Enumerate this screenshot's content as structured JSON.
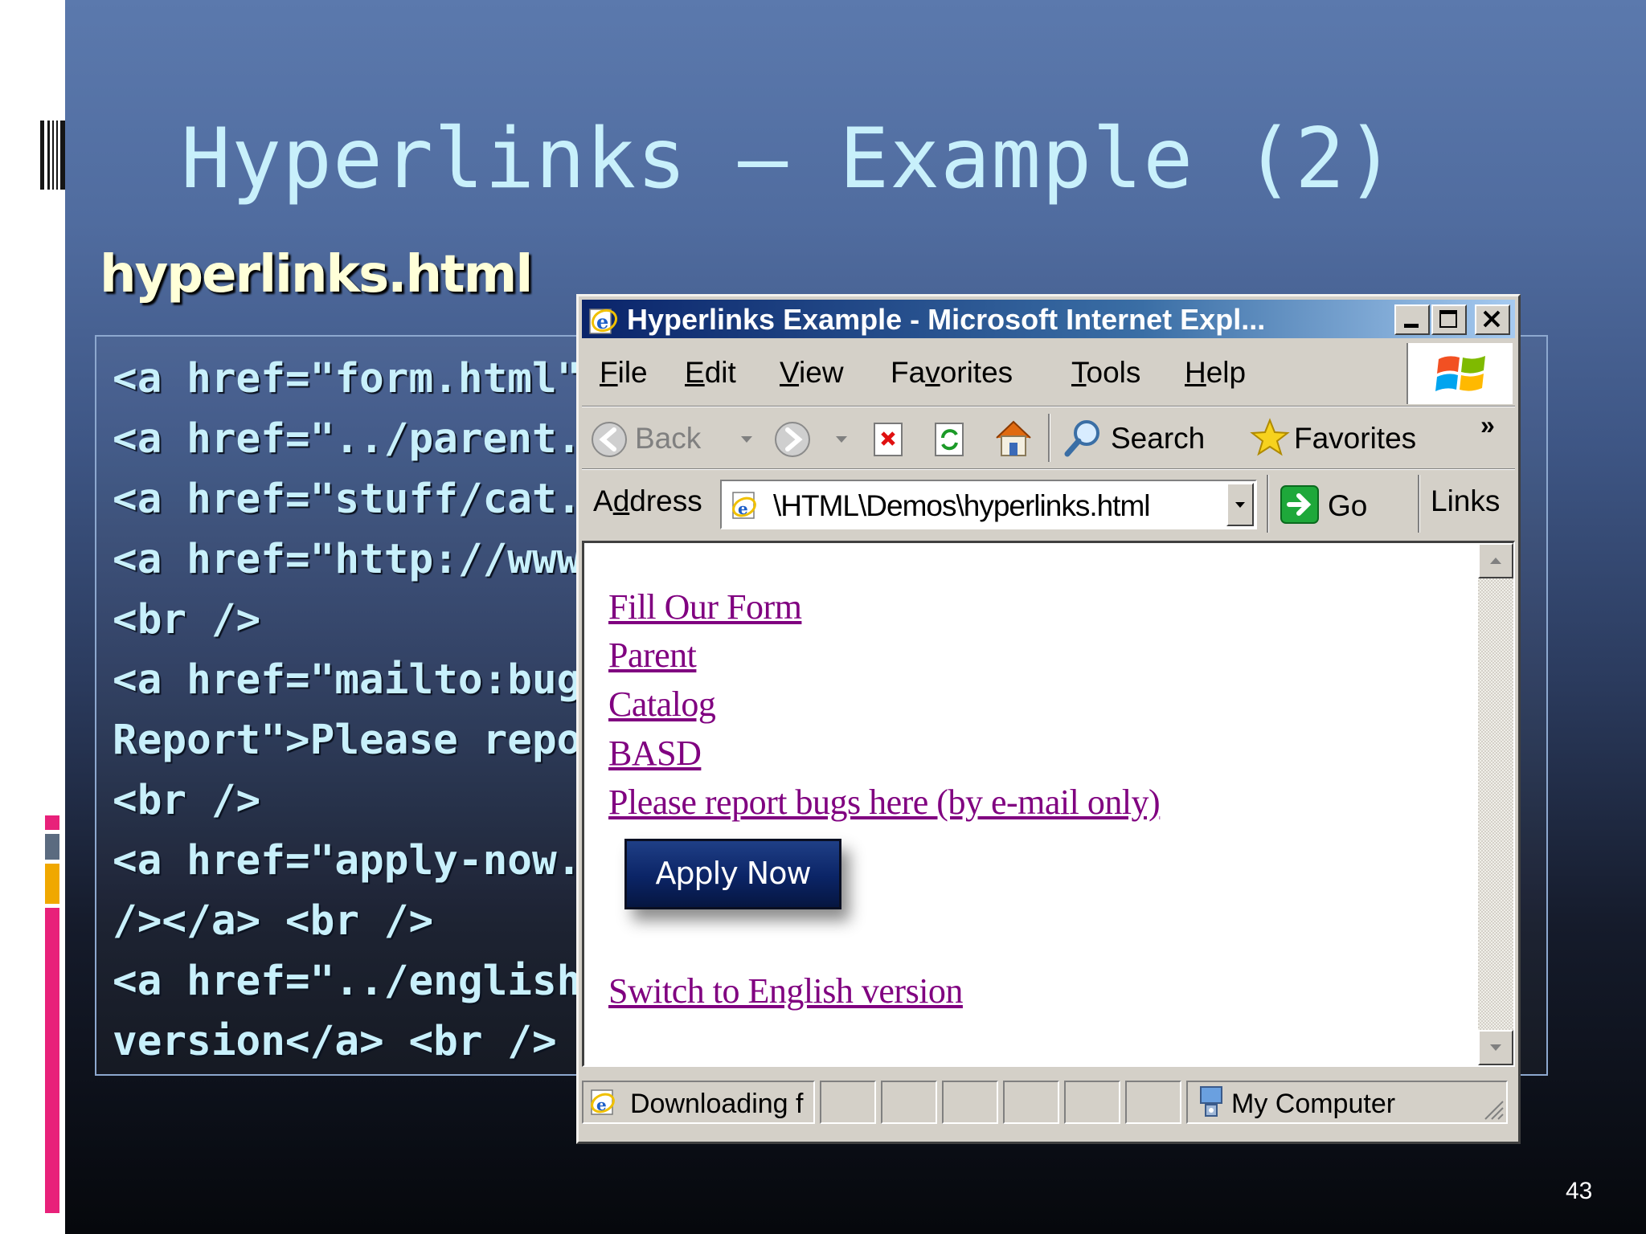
{
  "slide": {
    "title": "Hyperlinks – Example (2)",
    "file_name": "hyperlinks.html",
    "number": "43",
    "code_lines": [
      "<a href=\"form.html\"",
      "<a href=\"../parent.",
      "<a href=\"stuff/cat.",
      "<a href=\"http://www",
      "<br />",
      "<a href=\"mailto:bug",
      "Report\">Please repo",
      "<br />",
      "<a href=\"apply-now.",
      "/></a> <br />",
      "<a href=\"../english",
      "version</a> <br />"
    ]
  },
  "browser": {
    "title": "Hyperlinks Example - Microsoft Internet Expl...",
    "menu": [
      {
        "key": "F",
        "rest": "ile"
      },
      {
        "key": "E",
        "rest": "dit"
      },
      {
        "key": "V",
        "rest": "iew"
      },
      {
        "pre": "Fa",
        "key": "v",
        "rest": "orites"
      },
      {
        "key": "T",
        "rest": "ools"
      },
      {
        "key": "H",
        "rest": "elp"
      }
    ],
    "toolbar": {
      "back": "Back",
      "search": "Search",
      "favorites": "Favorites",
      "more": "»"
    },
    "address": {
      "label_pre": "A",
      "label_key": "d",
      "label_rest": "dress",
      "value": "\\HTML\\Demos\\hyperlinks.html",
      "go": "Go",
      "links": "Links"
    },
    "page_links": [
      "Fill Our Form",
      "Parent",
      "Catalog",
      "BASD",
      "Please report bugs here (by e-mail only)"
    ],
    "apply_button": "Apply Now",
    "english_link": "Switch to English version",
    "status": {
      "downloading": "Downloading f",
      "zone": "My Computer"
    }
  },
  "colors": {
    "code_text": "#c8f0fb",
    "file_name": "#ffffd8",
    "visited_link": "#800080",
    "titlebar_start": "#0a246a",
    "strip_pink": "#e8217a",
    "strip_gold": "#f0a800",
    "strip_slate": "#5b6b80"
  }
}
